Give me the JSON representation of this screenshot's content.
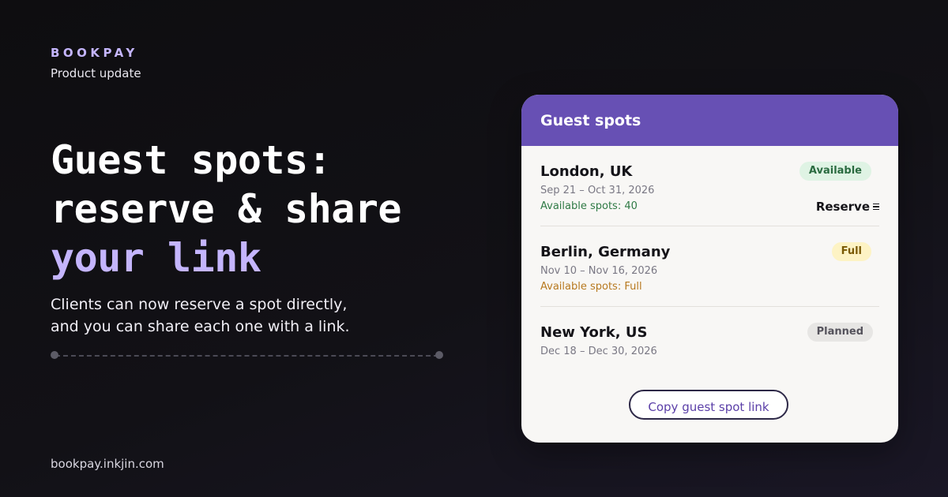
{
  "brand": "BOOKPAY",
  "subtitle": "Product update",
  "headline": {
    "line1": "Guest spots:",
    "line2": "reserve & share",
    "line3": "your link"
  },
  "description": {
    "line1": "Clients can now reserve a spot directly,",
    "line2": "and you can share each one with a link."
  },
  "footer_url": "bookpay.inkjin.com",
  "card": {
    "title": "Guest spots",
    "spots": [
      {
        "city": "London, UK",
        "dates": "Sep 21 – Oct 31, 2026",
        "availability": "Available spots: 40",
        "status": "Available",
        "action": "Reserve"
      },
      {
        "city": "Berlin, Germany",
        "dates": "Nov 10 – Nov 16, 2026",
        "availability": "Available spots: Full",
        "status": "Full"
      },
      {
        "city": "New York, US",
        "dates": "Dec 18 – Dec 30, 2026",
        "status": "Planned"
      }
    ],
    "copy_button": "Copy guest spot link"
  },
  "colors": {
    "accent": "#c4b5fd",
    "header": "#6750b4",
    "available": "#2f7a45",
    "full": "#b7791f"
  },
  "icons": {
    "reserve": "menu-icon"
  }
}
